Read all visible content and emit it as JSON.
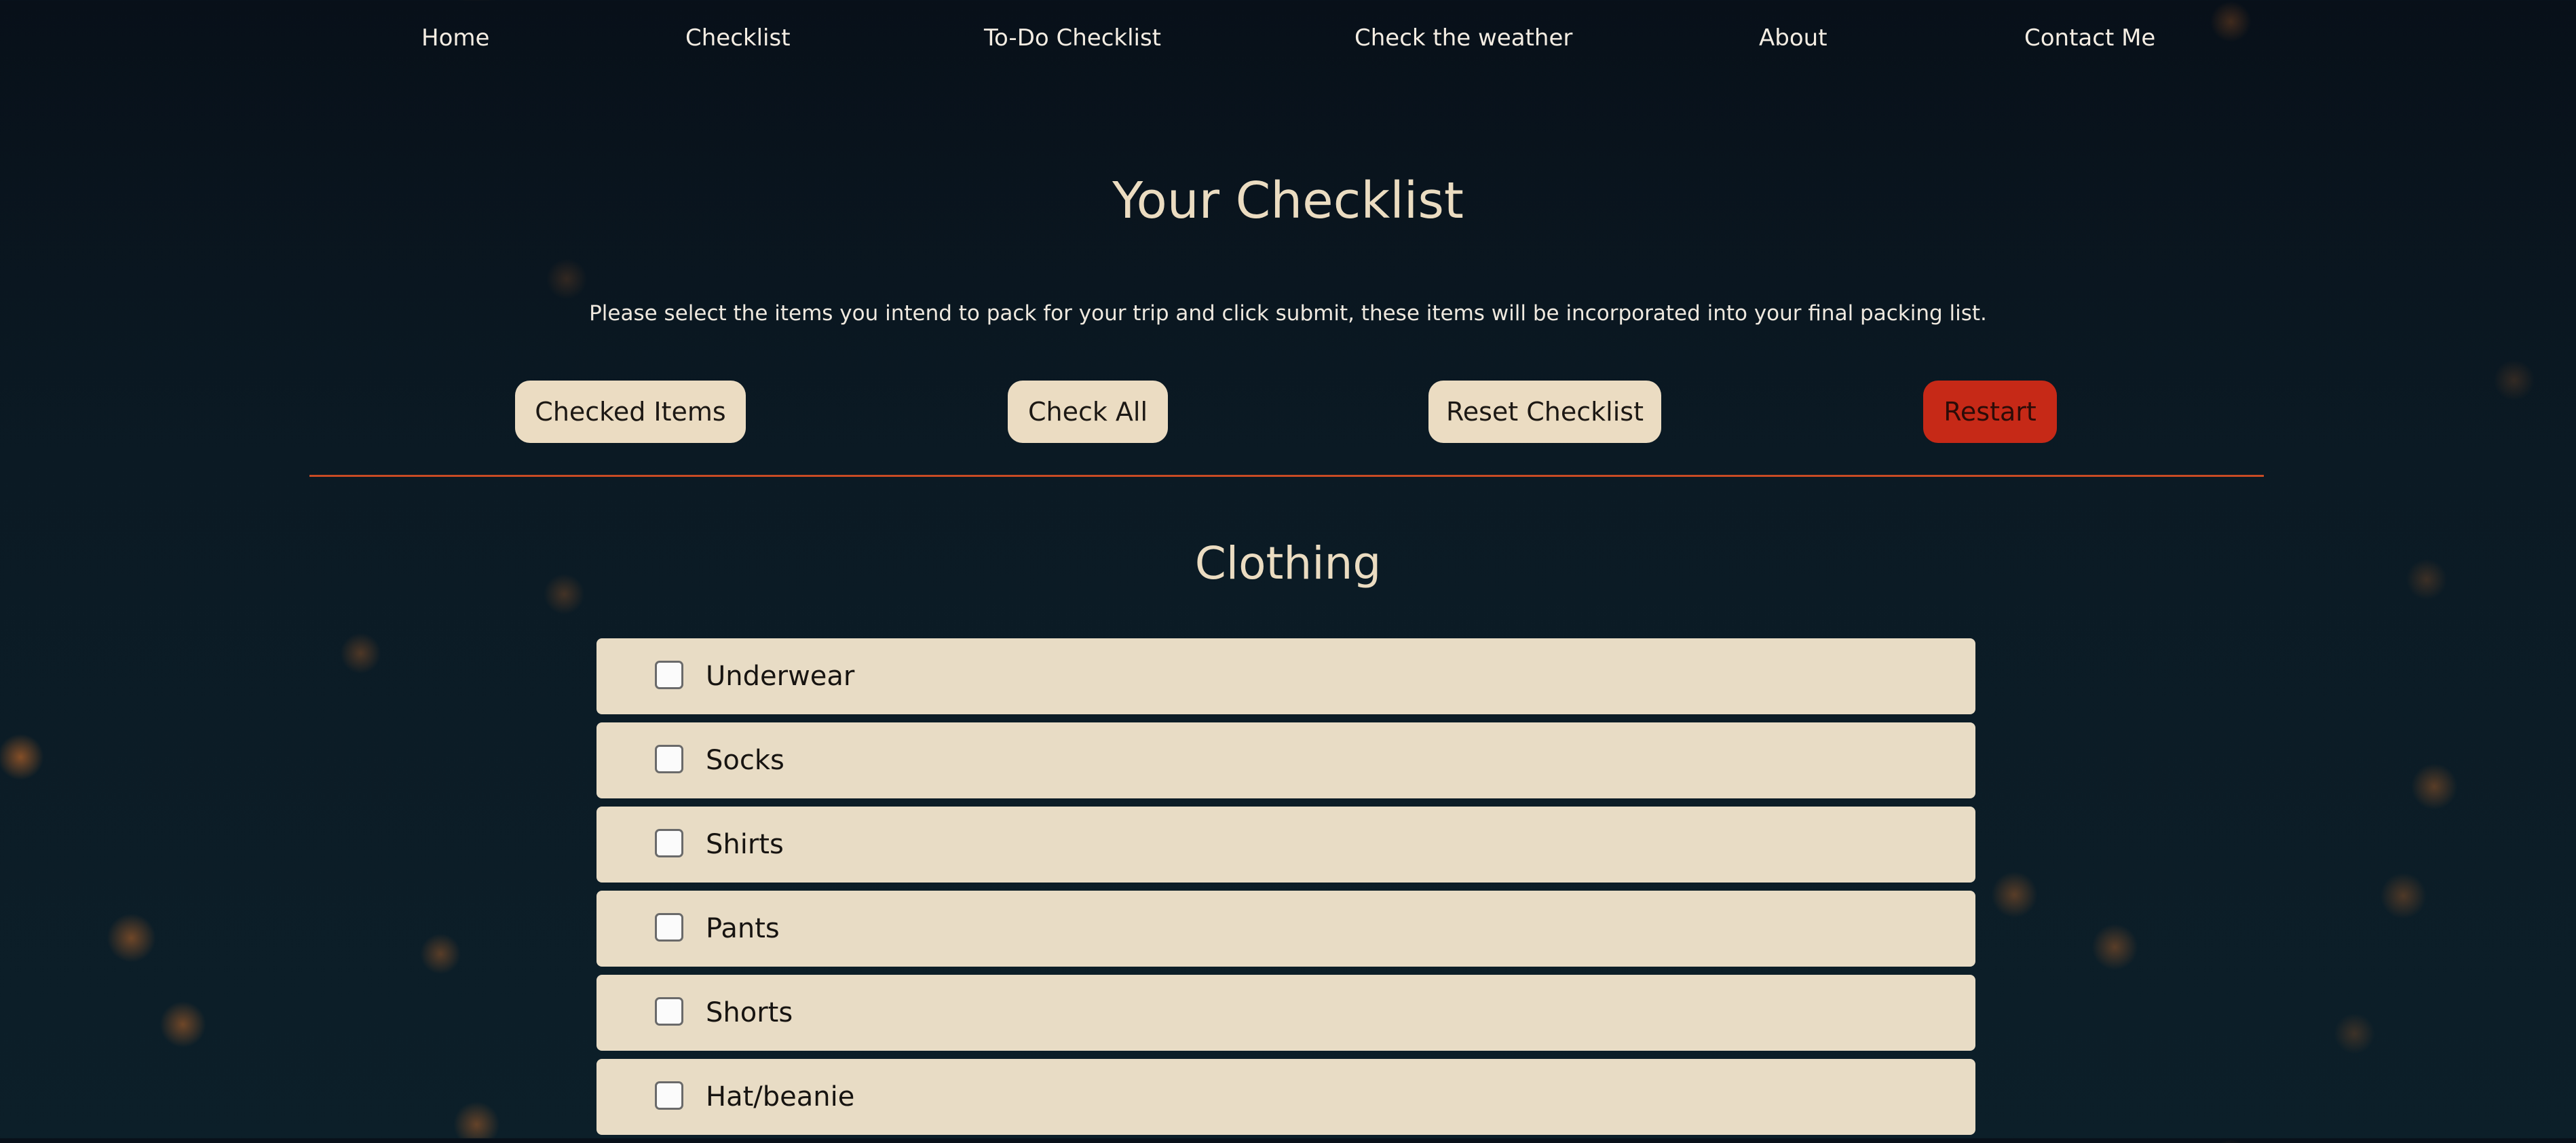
{
  "nav": {
    "items": [
      {
        "label": "Home"
      },
      {
        "label": "Checklist"
      },
      {
        "label": "To-Do Checklist"
      },
      {
        "label": "Check the weather"
      },
      {
        "label": "About"
      },
      {
        "label": "Contact Me"
      }
    ]
  },
  "page": {
    "title": "Your Checklist",
    "instructions": "Please select the items you intend to pack for your trip and click submit, these items will be incorporated into your final packing list."
  },
  "actions": {
    "checked_items": "Checked Items",
    "check_all": "Check All",
    "reset_checklist": "Reset Checklist",
    "restart": "Restart"
  },
  "section": {
    "title": "Clothing",
    "items": [
      {
        "label": "Underwear",
        "checked": false
      },
      {
        "label": "Socks",
        "checked": false
      },
      {
        "label": "Shirts",
        "checked": false
      },
      {
        "label": "Pants",
        "checked": false
      },
      {
        "label": "Shorts",
        "checked": false
      },
      {
        "label": "Hat/beanie",
        "checked": false
      }
    ]
  },
  "colors": {
    "background": "#0b1a24",
    "card": "#e8dcc5",
    "button": "#ebdcc2",
    "restart_button": "#c62917",
    "divider": "#c84b24",
    "heading": "#ebdcc1"
  }
}
